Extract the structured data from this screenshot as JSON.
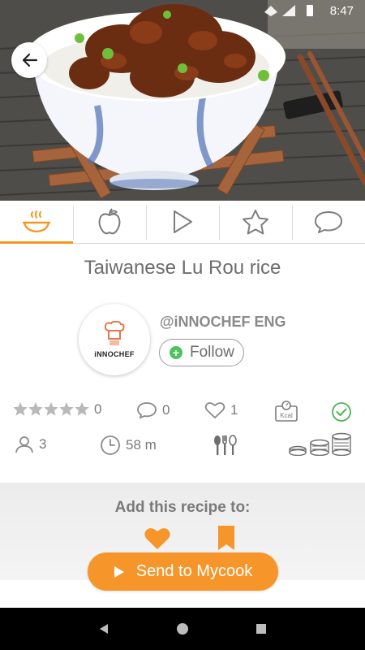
{
  "status_bar": {
    "time": "8:47",
    "icons": [
      "wifi-icon",
      "signal-icon",
      "battery-icon"
    ]
  },
  "hero": {
    "image": "rice-bowl-photo"
  },
  "tabs": [
    {
      "name": "cooking-pot-icon",
      "active": true
    },
    {
      "name": "apple-icon",
      "active": false
    },
    {
      "name": "play-icon",
      "active": false
    },
    {
      "name": "star-icon",
      "active": false
    },
    {
      "name": "comment-icon",
      "active": false
    }
  ],
  "recipe": {
    "title": "Taiwanese Lu Rou rice"
  },
  "author": {
    "avatar_text": "iNNOCHEF",
    "name": "@iNNOCHEF ENG",
    "follow_label": "Follow"
  },
  "stats": {
    "rating_stars": 5,
    "rating_count": "0",
    "comments": "0",
    "likes": "1",
    "people": "3",
    "time": "58 m"
  },
  "actions": {
    "add_title": "Add this recipe to:",
    "send_label": "Send to Mycook"
  },
  "colors": {
    "accent": "#f7941d",
    "follow_green": "#4cc35b",
    "check_green": "#4cb050",
    "text_gray": "#7a7a7a"
  }
}
